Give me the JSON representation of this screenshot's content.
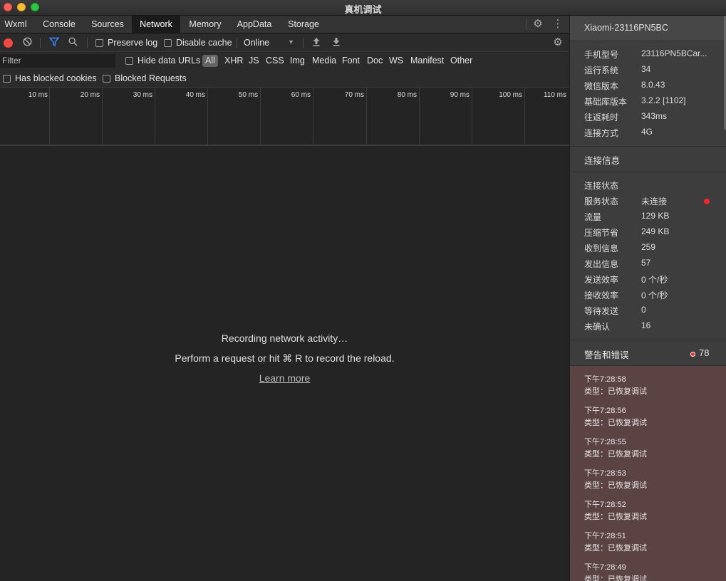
{
  "window": {
    "title": "真机调试"
  },
  "tabs": [
    "Wxml",
    "Console",
    "Sources",
    "Network",
    "Memory",
    "AppData",
    "Storage"
  ],
  "active_tab": "Network",
  "toolbar": {
    "preserve_log": "Preserve log",
    "disable_cache": "Disable cache",
    "throttle": "Online",
    "throttle_arrow": "▼"
  },
  "filter": {
    "placeholder": "Filter",
    "hide_data_urls": "Hide data URLs",
    "types": [
      "All",
      "XHR",
      "JS",
      "CSS",
      "Img",
      "Media",
      "Font",
      "Doc",
      "WS",
      "Manifest",
      "Other"
    ],
    "has_blocked_cookies": "Has blocked cookies",
    "blocked_requests": "Blocked Requests"
  },
  "timeline": {
    "ticks": [
      "10 ms",
      "20 ms",
      "30 ms",
      "40 ms",
      "50 ms",
      "60 ms",
      "70 ms",
      "80 ms",
      "90 ms",
      "100 ms",
      "110 ms"
    ]
  },
  "empty": {
    "line1": "Recording network activity…",
    "line2": "Perform a request or hit ⌘ R to record the reload.",
    "link": "Learn more"
  },
  "device": {
    "name": "Xiaomi-23116PN5BC",
    "info": [
      {
        "k": "手机型号",
        "v": "23116PN5BCar..."
      },
      {
        "k": "运行系统",
        "v": "34"
      },
      {
        "k": "微信版本",
        "v": "8.0.43"
      },
      {
        "k": "基础库版本",
        "v": "3.2.2 [1102]"
      },
      {
        "k": "往返耗时",
        "v": "343ms"
      },
      {
        "k": "连接方式",
        "v": "4G"
      }
    ],
    "conn_header": "连接信息",
    "conn": [
      {
        "k": "连接状态",
        "v": ""
      },
      {
        "k": "服务状态",
        "v": "未连接"
      },
      {
        "k": "流量",
        "v": "129 KB"
      },
      {
        "k": "压缩节省",
        "v": "249 KB"
      },
      {
        "k": "收到信息",
        "v": "259"
      },
      {
        "k": "发出信息",
        "v": "57"
      },
      {
        "k": "发送效率",
        "v": "0 个/秒"
      },
      {
        "k": "接收效率",
        "v": "0 个/秒"
      },
      {
        "k": "等待发送",
        "v": "0"
      },
      {
        "k": "未确认",
        "v": "16"
      }
    ],
    "warn_header": "警告和错误",
    "warn_count": "78",
    "logs": [
      {
        "time": "下午7:28:58",
        "type": "类型：已恢复调试"
      },
      {
        "time": "下午7:28:56",
        "type": "类型：已恢复调试"
      },
      {
        "time": "下午7:28:55",
        "type": "类型：已恢复调试"
      },
      {
        "time": "下午7:28:53",
        "type": "类型：已恢复调试"
      },
      {
        "time": "下午7:28:52",
        "type": "类型：已恢复调试"
      },
      {
        "time": "下午7:28:51",
        "type": "类型：已恢复调试"
      },
      {
        "time": "下午7:28:49",
        "type": "类型：已恢复调试"
      }
    ]
  },
  "colors": {
    "record": "#f4463e",
    "status_dot": "#ff2222",
    "log_bg": "#5c4343",
    "filter_icon": "#3d8bff"
  }
}
